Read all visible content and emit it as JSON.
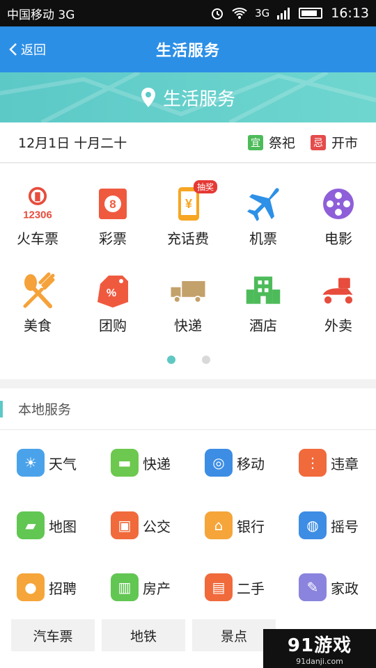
{
  "status_bar": {
    "carrier": "中国移动 3G",
    "network": "3G",
    "time": "16:13"
  },
  "nav": {
    "back_label": "返回",
    "title": "生活服务"
  },
  "banner": {
    "title": "生活服务"
  },
  "date_bar": {
    "date": "12月1日 十月二十",
    "yi_tag": "宜",
    "yi_text": "祭祀",
    "ji_tag": "忌",
    "ji_text": "开市"
  },
  "grid": {
    "items": [
      {
        "label": "火车票",
        "icon": "train-icon",
        "icon_text": "12306"
      },
      {
        "label": "彩票",
        "icon": "lottery-icon",
        "icon_text": "8"
      },
      {
        "label": "充话费",
        "icon": "phone-recharge-icon",
        "icon_text": "¥",
        "badge": "抽奖"
      },
      {
        "label": "机票",
        "icon": "plane-icon"
      },
      {
        "label": "电影",
        "icon": "film-icon"
      },
      {
        "label": "美食",
        "icon": "food-icon"
      },
      {
        "label": "团购",
        "icon": "group-buy-icon",
        "icon_text": "%"
      },
      {
        "label": "快递",
        "icon": "truck-icon"
      },
      {
        "label": "酒店",
        "icon": "hotel-icon"
      },
      {
        "label": "外卖",
        "icon": "scooter-icon"
      }
    ],
    "page": 1,
    "pages": 2
  },
  "local": {
    "title": "本地服务",
    "items": [
      {
        "label": "天气",
        "icon": "sun-icon",
        "color": "#4aa3ea"
      },
      {
        "label": "快递",
        "icon": "truck-icon",
        "color": "#6cc84e"
      },
      {
        "label": "移动",
        "icon": "china-mobile-icon",
        "color": "#3d8de4"
      },
      {
        "label": "违章",
        "icon": "traffic-light-icon",
        "color": "#f06a3c"
      },
      {
        "label": "地图",
        "icon": "map-icon",
        "color": "#62c653"
      },
      {
        "label": "公交",
        "icon": "bus-icon",
        "color": "#f06a3c"
      },
      {
        "label": "银行",
        "icon": "bank-icon",
        "color": "#f5a53a"
      },
      {
        "label": "摇号",
        "icon": "car-icon",
        "color": "#3d8de4"
      },
      {
        "label": "招聘",
        "icon": "person-icon",
        "color": "#f5a53a"
      },
      {
        "label": "房产",
        "icon": "building-icon",
        "color": "#62c653"
      },
      {
        "label": "二手",
        "icon": "cart-icon",
        "color": "#f06a3c"
      },
      {
        "label": "家政",
        "icon": "broom-icon",
        "color": "#8a84de"
      }
    ],
    "buttons": [
      "汽车票",
      "地铁",
      "景点"
    ]
  },
  "watermark": {
    "brand": "91游戏",
    "site": "91danji.com"
  }
}
